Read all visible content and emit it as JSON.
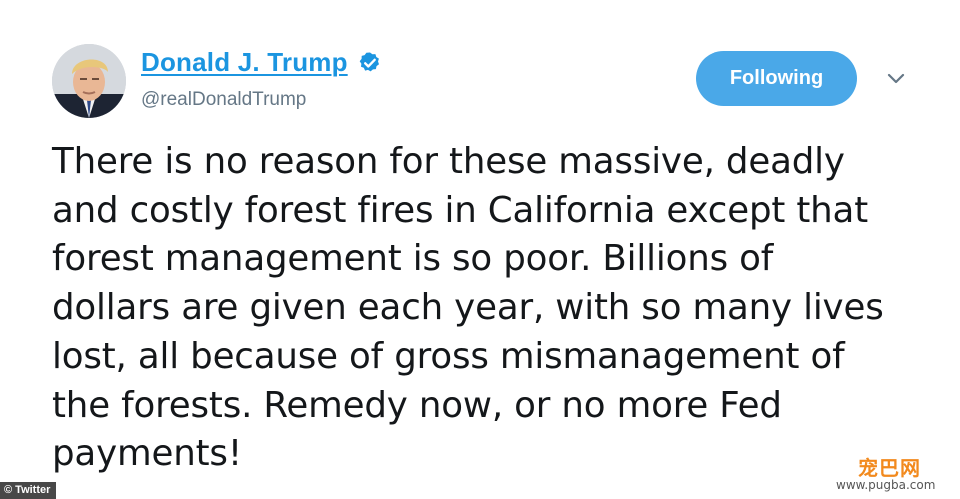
{
  "tweet": {
    "author": {
      "display_name": "Donald J. Trump",
      "handle": "@realDonaldTrump",
      "verified": true
    },
    "follow_button_label": "Following",
    "text_lines": [
      "There is no reason for these massive, deadly",
      "and costly forest fires in California except that",
      "forest management is so poor. Billions of",
      "dollars are given each year, with so many lives",
      "lost, all because of gross mismanagement of",
      "the forests. Remedy now, or no more Fed",
      "payments!"
    ]
  },
  "overlay": {
    "source_caption": "© Twitter",
    "watermark_logo": "宠巴网",
    "watermark_url": "www.pugba.com"
  },
  "icons": {
    "verified": "verified-check-icon",
    "more": "chevron-down-icon"
  },
  "colors": {
    "link_blue": "#1b95e0",
    "button_blue": "#4aa8e8",
    "text": "#14171a",
    "muted": "#657786",
    "watermark_orange": "#f28a1e"
  }
}
